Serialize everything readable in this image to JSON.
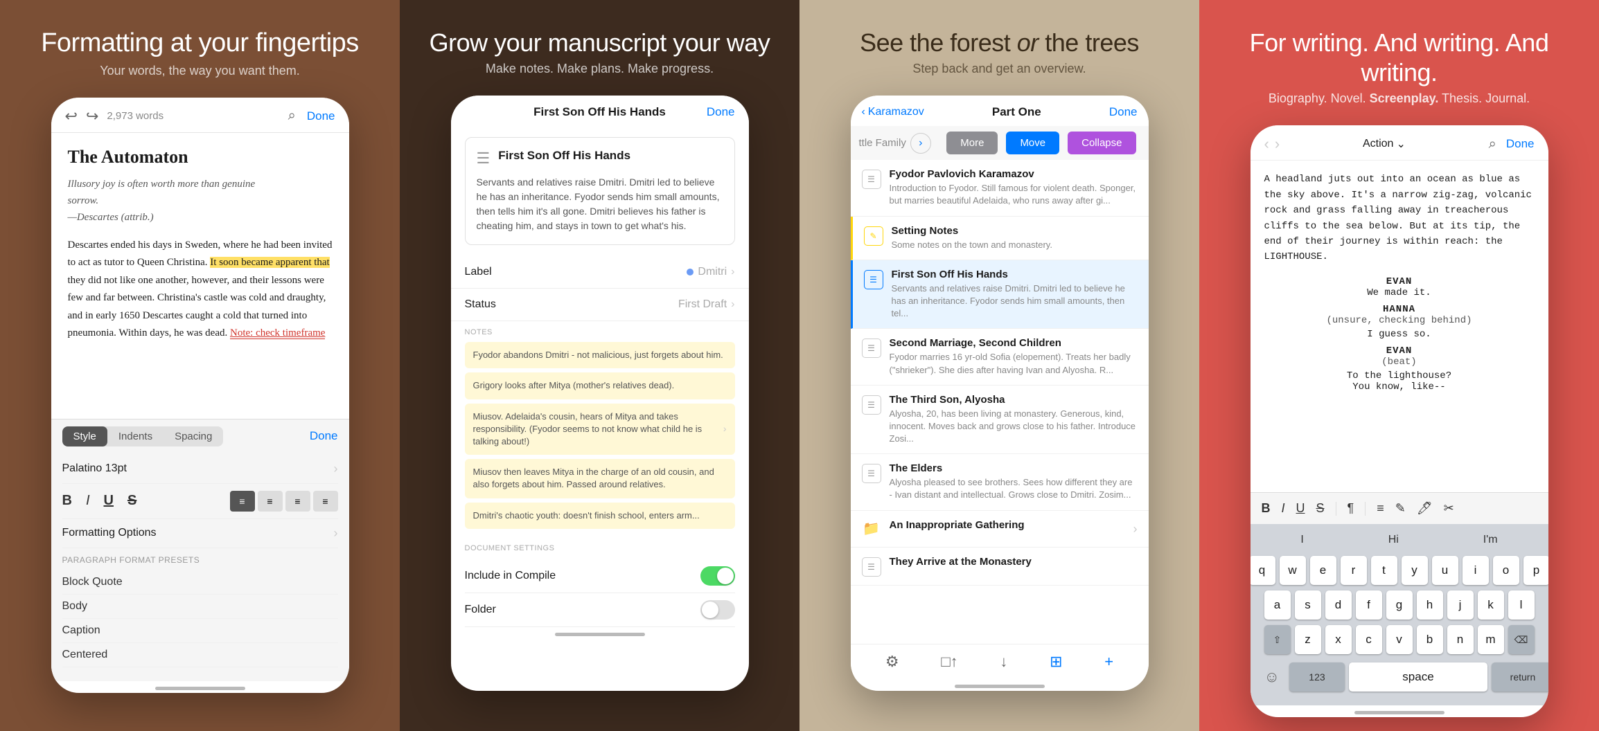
{
  "panel1": {
    "title": "Formatting at your fingertips",
    "subtitle": "Your words, the way you want them.",
    "nav": {
      "words": "2,973 words",
      "done": "Done"
    },
    "doc": {
      "title": "The Automaton",
      "quote": "Illusory joy is often worth more than genuine sorrow.\n—Descartes (attrib.)",
      "body1": "Descartes ended his days in Sweden, where he had been invited to act as tutor to Queen Christina. It soon became apparent that they did not like one another, however, and their lessons were few and far between. Christina's castle was cold and draughty, and in early 1650 Descartes caught a cold that turned into pneumonia. Within days, he was dead.",
      "note": "Note: check timeframe"
    },
    "format": {
      "tabs": [
        "Style",
        "Indents",
        "Spacing"
      ],
      "done": "Done",
      "font": "Palatino 13pt",
      "presets_label": "PARAGRAPH FORMAT PRESETS",
      "presets": [
        "Block Quote",
        "Body",
        "Caption",
        "Centered"
      ]
    }
  },
  "panel2": {
    "title": "Grow your manuscript your way",
    "subtitle": "Make notes. Make plans. Make progress.",
    "nav": {
      "title": "First Son Off His Hands",
      "done": "Done"
    },
    "scene": {
      "title": "First Son Off His Hands",
      "text": "Servants and relatives raise Dmitri. Dmitri led to believe he has an inheritance. Fyodor sends him small amounts, then tells him it's all gone. Dmitri believes his father is cheating him, and stays in town to get what's his."
    },
    "label": {
      "label": "Label",
      "value": "Dmitri"
    },
    "status": {
      "label": "Status",
      "value": "First Draft"
    },
    "notes": {
      "section_label": "NOTES",
      "items": [
        "Fyodor abandons Dmitri - not malicious, just forgets about him.",
        "Grigory looks after Mitya (mother's relatives dead).",
        "Miusov. Adelaida's cousin, hears of Mitya and takes responsibility. (Fyodor seems to not know what child he is talking about!)",
        "Miusov then leaves Mitya in the charge of an old cousin, and also forgets about him. Passed around relatives.",
        "Dmitri's chaotic youth: doesn't finish school, enters arm..."
      ]
    },
    "doc_settings": {
      "label": "DOCUMENT SETTINGS",
      "include_compile": "Include in Compile",
      "folder": "Folder"
    }
  },
  "panel3": {
    "title": "See the forest",
    "title_or": "or",
    "title2": "the trees",
    "subtitle": "Step back and get an overview.",
    "nav": {
      "back": "Karamazov",
      "title": "Part One",
      "done": "Done"
    },
    "actions": {
      "more": "More",
      "move": "Move",
      "collapse": "Collapse"
    },
    "filter": "ttle Family",
    "items": [
      {
        "title": "Fyodor Pavlovich Karamazov",
        "desc": "Introduction to Fyodor. Still famous for violent death. Sponger, but marries beautiful Adelaida, who runs away after gi..."
      },
      {
        "title": "Setting Notes",
        "desc": "Some notes on the town and monastery."
      },
      {
        "title": "First Son Off His Hands",
        "desc": "Servants and relatives raise Dmitri. Dmitri led to believe he has an inheritance. Fyodor sends him small amounts, then tel..."
      },
      {
        "title": "Second Marriage, Second Children",
        "desc": "Fyodor marries 16 yr-old Sofia (elopement). Treats her badly (\"shrieker\"). She dies after having Ivan and Alyosha. R..."
      },
      {
        "title": "The Third Son, Alyosha",
        "desc": "Alyosha, 20, has been living at monastery. Generous, kind, innocent. Moves back and grows close to his father. Introduce Zosi..."
      },
      {
        "title": "The Elders",
        "desc": "Alyosha pleased to see brothers. Sees how different they are - Ivan distant and intellectual. Grows close to Dmitri. Zosim..."
      },
      {
        "title": "An Inappropriate Gathering",
        "desc": ""
      },
      {
        "title": "They Arrive at the Monastery",
        "desc": ""
      }
    ]
  },
  "panel4": {
    "title": "For writing. And writing. And writing.",
    "subtitle": "Biography. Novel. Screenplay. Thesis. Journal.",
    "nav": {
      "action": "Action",
      "done": "Done"
    },
    "screenplay": {
      "desc": "A headland juts out into an ocean as blue as the sky above. It's a narrow zig-zag, volcanic rock and grass falling away in treacherous cliffs to the sea below. But at its tip, the end of their journey is within reach: the LIGHTHOUSE.",
      "scenes": [
        {
          "char": "EVAN",
          "action": "",
          "dialogue": "We made it."
        },
        {
          "char": "HANNA",
          "action": "(unsure, checking behind)",
          "dialogue": "I guess so."
        },
        {
          "char": "EVAN",
          "action": "(beat)",
          "dialogue": "To the lighthouse?\nYou know, like--"
        }
      ]
    },
    "keyboard": {
      "top_row": [
        "I",
        "Hi",
        "I'm"
      ],
      "rows": [
        [
          "q",
          "w",
          "e",
          "r",
          "t",
          "y",
          "u",
          "i",
          "o",
          "p"
        ],
        [
          "a",
          "s",
          "d",
          "f",
          "g",
          "h",
          "j",
          "k",
          "l"
        ],
        [
          "z",
          "x",
          "c",
          "v",
          "b",
          "n",
          "m"
        ]
      ],
      "special": {
        "shift": "⇧",
        "delete": "⌫",
        "numbers": "123",
        "space": "space",
        "return": "return"
      }
    }
  }
}
